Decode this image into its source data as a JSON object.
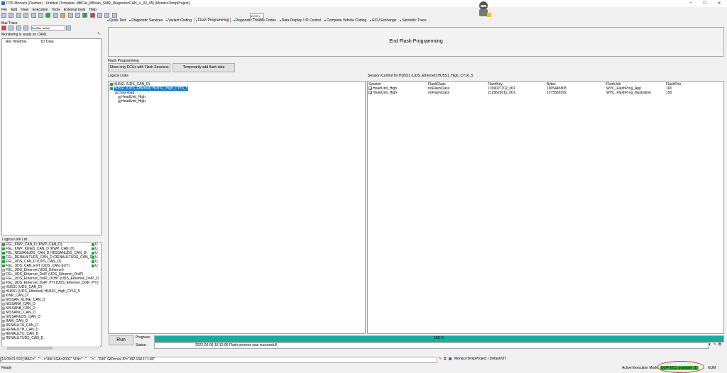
{
  "window": {
    "title": "DTS Monaco (Daimler) - Untitled (Template: MBCar_MBVan_SMR_DiagnosticCAN_V_02_05) [MonacoTempProject]",
    "minimize": "–",
    "maximize": "☐",
    "close": "✕"
  },
  "menu": [
    "File",
    "Edit",
    "View",
    "Execution",
    "Tools",
    "External tools",
    "Help"
  ],
  "toolbar": {
    "filter_label": "No filter active",
    "counter": "13.99 V"
  },
  "tabs": [
    "Quick Text",
    "Diagnostic Services",
    "Variant Coding",
    "Flash Programming",
    "Diagnostic Trouble Codes",
    "Data Display / IO Control",
    "Complete Vehicle Coding",
    "ECU Exchange",
    "Symbolic Trace"
  ],
  "active_tab_index": 3,
  "bus_trace": {
    "title": "Bus Trace",
    "filter": "No filter active",
    "status": "Monitoring is ready on CAN1.",
    "cols": [
      "Rel.Time[ms]",
      "ID",
      "Data"
    ]
  },
  "logical_link_list": {
    "title": "Logical Link List",
    "items": [
      {
        "label": "FGL_KWP_CAN_D (KWP_CAN_D)",
        "suffix": "U",
        "checked": true
      },
      {
        "label": "FGL_KWP_KlinE5_CAN_D (KWP_CAN_D)",
        "suffix": "U",
        "checked": true
      },
      {
        "label": "FGL_NISSANUDS_CAN_D (NISSANUDS_CAN_D)",
        "suffix": "U",
        "checked": true
      },
      {
        "label": "FGL_RENAULTUDS_CAN_D (RENAULTUDS_CAN_D)",
        "suffix": "U",
        "checked": true
      },
      {
        "label": "FGL_UDS_CAN_D (UDS_CAN_D)",
        "suffix": "U",
        "checked": true
      },
      {
        "label": "FGL_UDS_CAN_EXT (UDS_CAN_EXT)",
        "suffix": "U",
        "checked": true
      },
      {
        "label": "FGL_UDS_Ethernet (UDS_Ethernet)",
        "suffix": "",
        "checked": false
      },
      {
        "label": "FGL_UDS_Ethernet_DoIP (UDS_Ethernet_DoIP)",
        "suffix": "",
        "checked": false
      },
      {
        "label": "FGL_UDS_Ethernet_DoIP_DOBT (UDS_Ethernet_DoIP_D...",
        "suffix": "",
        "checked": false
      },
      {
        "label": "FGL_UDS_Ethernet_DoIP_PTI (UDS_Ethernet_DoIP_PTI)",
        "suffix": "",
        "checked": false
      },
      {
        "label": "HU5S1 (UDS_CAN_D)",
        "suffix": "",
        "checked": false
      },
      {
        "label": "HU5S1 (UDS_Ethernet) HU5S1_High_CY16_5",
        "suffix": "",
        "checked": false
      },
      {
        "label": "KWP_CAN_D",
        "suffix": "",
        "checked": false
      },
      {
        "label": "NISSAN_KLINE_CAN_D",
        "suffix": "",
        "checked": false
      },
      {
        "label": "NISSANA_CAN_D",
        "suffix": "",
        "checked": false
      },
      {
        "label": "NISSANB_CAN_D",
        "suffix": "",
        "checked": false
      },
      {
        "label": "NISSANC_CAN_D",
        "suffix": "",
        "checked": false
      },
      {
        "label": "NISSANUDS_CAN_D",
        "suffix": "",
        "checked": false
      },
      {
        "label": "RAW_CAN_D",
        "suffix": "",
        "checked": false
      },
      {
        "label": "RENAULTA_CAN_D",
        "suffix": "",
        "checked": false
      },
      {
        "label": "RENAULTB_CAN_D",
        "suffix": "",
        "checked": false
      },
      {
        "label": "RENAULTC_CAN_D",
        "suffix": "",
        "checked": false
      },
      {
        "label": "RENAULTUDS_CAN_D",
        "suffix": "",
        "checked": false
      }
    ]
  },
  "main": {
    "end_button": "End Flash Programming",
    "section_title": "Flash Programming",
    "show_only_button": "Show only ECUs with Flash Sessions",
    "temp_add_button": "Temporarily add flash data",
    "logical_links_title": "Logical Links",
    "tree": [
      "HU5S1 (UDS_CAN_D)",
      "HU5S1 (UDS_Ethernet) HU5S1_High_CY16_5",
      "Download",
      "HeadUnit_High",
      "HeadUnit_High"
    ],
    "session_title": "Session Control for HU5S1 (UDS_Ethernet) HU5S1_High_CY16_5",
    "session_cols": [
      "Session",
      "FlashClass",
      "FlashKey",
      "Bytes",
      "FlashJob",
      "FlashPrio"
    ],
    "session_rows": [
      [
        "HeadUnit_High",
        "noFlashClass",
        "1769027702_001",
        "1905445808",
        "WVC_FlashProg_App",
        "100"
      ],
      [
        "HeadUnit_High",
        "noFlashClass",
        "2129626011_001",
        "1275582092",
        "WVC_FlashProg_Illustration",
        "150"
      ]
    ],
    "run_button": "Run",
    "progress_label": "Progress:",
    "progress_text": "100 %",
    "progress_value": 1.0,
    "status_label": "Status:",
    "status_text": "2022-06-06 15:12:06  Flash process was successful!"
  },
  "bottom": {
    "log_text": "[14:09:01.520] MAC=\"...\" ...=\"AW LGA=2001\" VIN=\"...\" ...\"=\"...\"030\" GID=n/a' IP=\"192.168.171.80\"",
    "project": "MonacoTempProject / DefaultVIT"
  },
  "statusbar": {
    "ready": "Ready",
    "mode": "Active Execution Mode",
    "ecu": "DoIP ECU available (1)",
    "num": "NUM"
  },
  "colors": {
    "accent": "#0078d7",
    "progress": "#0fb0a0",
    "ok": "#37c337",
    "highlight": "#e53030"
  }
}
